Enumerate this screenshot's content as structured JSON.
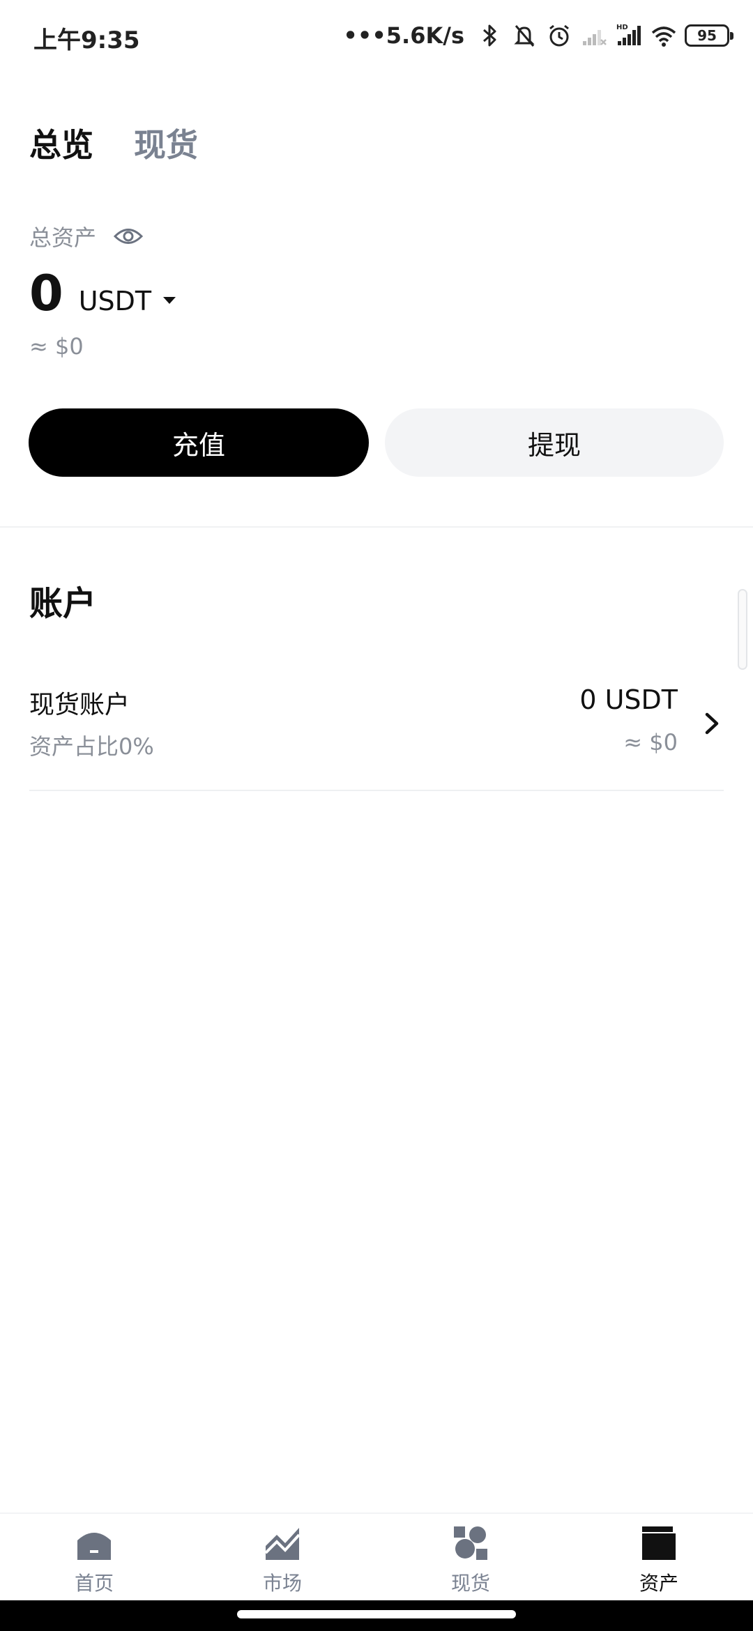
{
  "status_bar": {
    "time": "上午9:35",
    "network_speed": "•••5.6K/s",
    "battery": "95"
  },
  "top_tabs": [
    {
      "label": "总览",
      "active": true
    },
    {
      "label": "现货",
      "active": false
    }
  ],
  "overview": {
    "total_label": "总资产",
    "amount": "0",
    "unit": "USDT",
    "approx": "≈ $0"
  },
  "actions": {
    "deposit": "充值",
    "withdraw": "提现"
  },
  "accounts": {
    "title": "账户",
    "items": [
      {
        "name": "现货账户",
        "ratio": "资产占比0%",
        "amount": "0 USDT",
        "approx": "≈ $0"
      }
    ]
  },
  "bottom_nav": [
    {
      "label": "首页",
      "icon": "home-icon",
      "active": false
    },
    {
      "label": "市场",
      "icon": "market-icon",
      "active": false
    },
    {
      "label": "现货",
      "icon": "spot-icon",
      "active": false
    },
    {
      "label": "资产",
      "icon": "assets-icon",
      "active": true
    }
  ],
  "colors": {
    "primary": "#000000",
    "secondary_button_bg": "#f3f4f6",
    "muted_text": "#8a8f98",
    "inactive_tab": "#7a8291"
  }
}
